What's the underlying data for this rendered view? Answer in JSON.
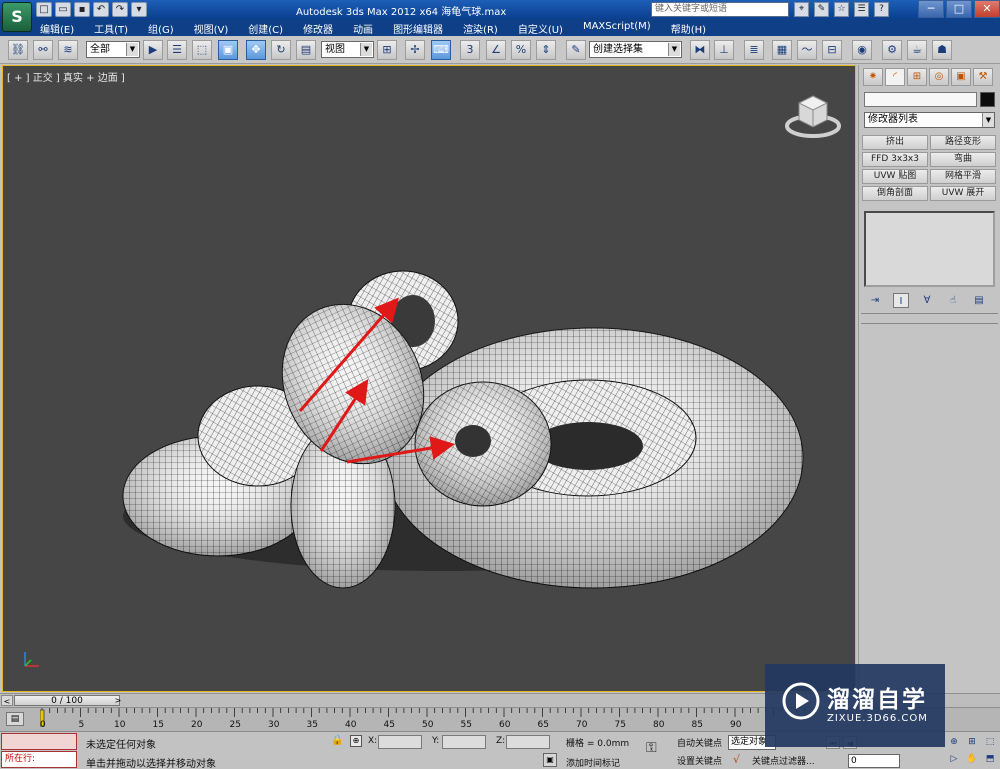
{
  "app": {
    "logo_text": "S",
    "title": "Autodesk 3ds Max  2012 x64      海龟气球.max",
    "search_placeholder": "键入关键字或短语"
  },
  "quick_access": {
    "icons": [
      "new-file-icon",
      "open-file-icon",
      "save-icon",
      "undo-icon",
      "redo-icon",
      "dropdown-icon"
    ],
    "glyphs": [
      "□",
      "▭",
      "▪",
      "↶",
      "↷",
      "▾"
    ]
  },
  "title_tools": {
    "icons": [
      "binoculars-icon",
      "tools-icon",
      "star-icon",
      "community-icon",
      "help-icon"
    ],
    "glyphs": [
      "⌖",
      "✎",
      "☆",
      "☰",
      "?"
    ]
  },
  "window_controls": {
    "minimize": "─",
    "maximize": "□",
    "close": "✕"
  },
  "menu": [
    "编辑(E)",
    "工具(T)",
    "组(G)",
    "视图(V)",
    "创建(C)",
    "修改器",
    "动画",
    "图形编辑器",
    "渲染(R)",
    "自定义(U)",
    "MAXScript(M)",
    "帮助(H)"
  ],
  "toolbar": {
    "selection_filter": "全部",
    "reference_coord": "视图",
    "snap_label": "3",
    "named_selection": "创建选择集"
  },
  "viewport": {
    "label": "[ + ] 正交 ] 真实 + 边面 ]",
    "annotation_color": "#e01818"
  },
  "command_panel": {
    "object_color": "#0b0b0b",
    "modifier_list": "修改器列表",
    "modifier_buttons": [
      "挤出",
      "路径变形",
      "FFD 3x3x3",
      "弯曲",
      "UVW 贴图",
      "网格平滑",
      "倒角剖面",
      "UVW 展开"
    ]
  },
  "timeline": {
    "frame_display": "0 / 100",
    "ticks": [
      "0",
      "5",
      "10",
      "15",
      "20",
      "25",
      "30",
      "35",
      "40",
      "45",
      "50",
      "55",
      "60",
      "65",
      "70",
      "75",
      "80",
      "85",
      "90"
    ]
  },
  "status": {
    "maxscript_running": "所在行: ",
    "selection_status": "未选定任何对象",
    "prompt": "单击并拖动以选择并移动对象",
    "x_label": "X:",
    "y_label": "Y:",
    "z_label": "Z:",
    "grid": "栅格 = 0.0mm",
    "time_tag": "添加时间标记",
    "auto_key": "自动关键点",
    "set_key": "设置关键点",
    "selected_object": "选定对象",
    "key_filters": "关键点过滤器...",
    "current_frame": "0"
  },
  "watermark": {
    "brand": "溜溜自学",
    "url": "ZIXUE.3D66.COM"
  }
}
